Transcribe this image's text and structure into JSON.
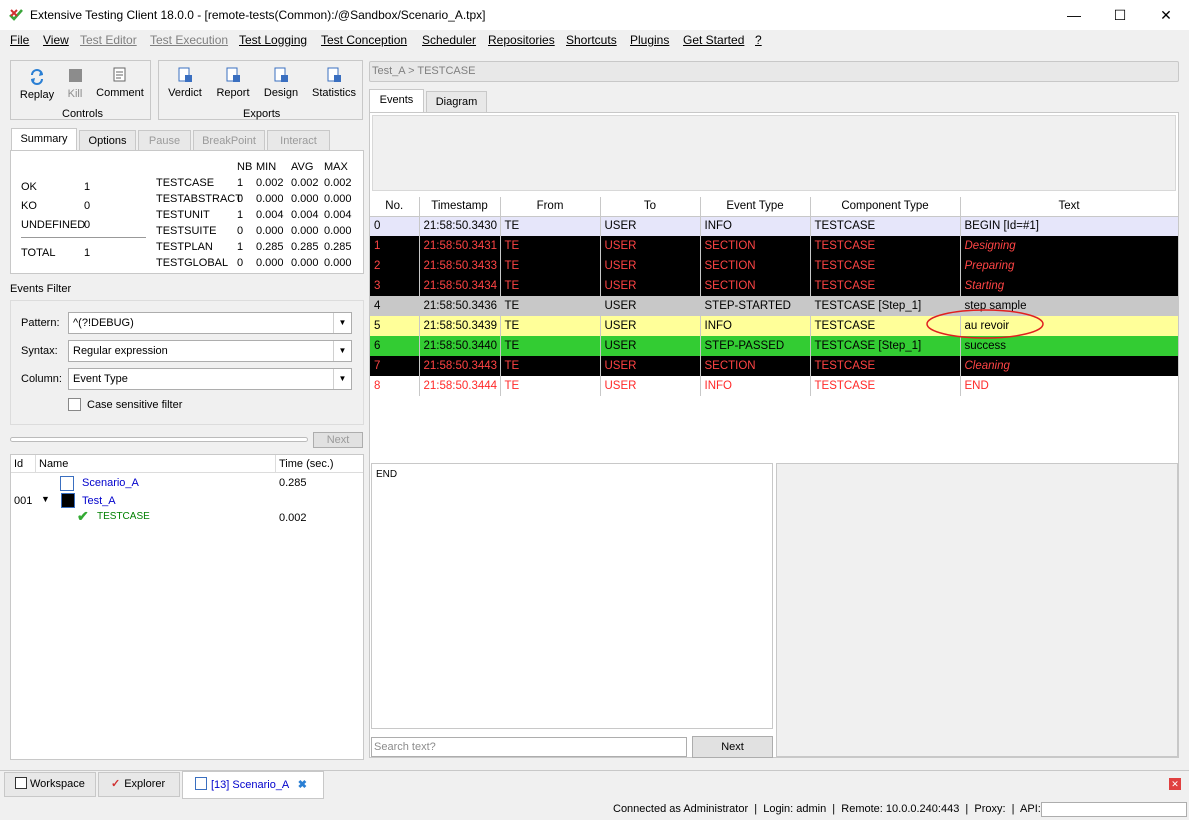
{
  "window": {
    "title": "Extensive Testing Client 18.0.0 - [remote-tests(Common):/@Sandbox/Scenario_A.tpx]",
    "min_glyph": "—",
    "max_glyph": "☐",
    "close_glyph": "✕"
  },
  "menu": [
    "File",
    "View",
    "Test Editor",
    "Test Execution",
    "Test Logging",
    "Test Conception",
    "Scheduler",
    "Repositories",
    "Shortcuts",
    "Plugins",
    "Get Started",
    "?"
  ],
  "controls": {
    "replay": "Replay",
    "kill": "Kill",
    "comment": "Comment",
    "group": "Controls"
  },
  "exports": {
    "verdict": "Verdict",
    "report": "Report",
    "design": "Design",
    "statistics": "Statistics",
    "group": "Exports"
  },
  "left_tabs": [
    "Summary",
    "Options",
    "Pause",
    "BreakPoint",
    "Interact"
  ],
  "summary": {
    "ok_label": "OK",
    "ok_val": "1",
    "ko_label": "KO",
    "ko_val": "0",
    "undef_label": "UNDEFINED",
    "undef_val": "0",
    "total_label": "TOTAL",
    "total_val": "1",
    "headers": [
      "NB",
      "MIN",
      "AVG",
      "MAX"
    ],
    "rows": [
      {
        "name": "TESTCASE",
        "nb": "1",
        "min": "0.002",
        "avg": "0.002",
        "max": "0.002"
      },
      {
        "name": "TESTABSTRACT",
        "nb": "0",
        "min": "0.000",
        "avg": "0.000",
        "max": "0.000"
      },
      {
        "name": "TESTUNIT",
        "nb": "1",
        "min": "0.004",
        "avg": "0.004",
        "max": "0.004"
      },
      {
        "name": "TESTSUITE",
        "nb": "0",
        "min": "0.000",
        "avg": "0.000",
        "max": "0.000"
      },
      {
        "name": "TESTPLAN",
        "nb": "1",
        "min": "0.285",
        "avg": "0.285",
        "max": "0.285"
      },
      {
        "name": "TESTGLOBAL",
        "nb": "0",
        "min": "0.000",
        "avg": "0.000",
        "max": "0.000"
      }
    ]
  },
  "filter": {
    "title": "Events Filter",
    "pattern_label": "Pattern:",
    "pattern_value": "^(?!DEBUG)",
    "syntax_label": "Syntax:",
    "syntax_value": "Regular expression",
    "column_label": "Column:",
    "column_value": "Event Type",
    "case_label": "Case sensitive filter",
    "next": "Next"
  },
  "tree": {
    "headers": [
      "Id",
      "Name",
      "Time (sec.)"
    ],
    "scenario": {
      "name": "Scenario_A",
      "time": "0.285"
    },
    "test": {
      "id": "001",
      "name": "Test_A"
    },
    "testcase": {
      "name": "TESTCASE",
      "time": "0.002"
    }
  },
  "breadcrumb": "Test_A > TESTCASE",
  "right_tabs": [
    "Events",
    "Diagram"
  ],
  "events": {
    "headers": [
      "No.",
      "Timestamp",
      "From",
      "To",
      "Event Type",
      "Component Type",
      "Text"
    ],
    "rows": [
      {
        "no": "0",
        "ts": "21:58:50.3430",
        "from": "TE",
        "to": "USER",
        "type": "INFO",
        "comp": "TESTCASE",
        "text": "BEGIN [Id=#1]",
        "style": "info-first"
      },
      {
        "no": "1",
        "ts": "21:58:50.3431",
        "from": "TE",
        "to": "USER",
        "type": "SECTION",
        "comp": "TESTCASE",
        "text": "Designing",
        "style": "section"
      },
      {
        "no": "2",
        "ts": "21:58:50.3433",
        "from": "TE",
        "to": "USER",
        "type": "SECTION",
        "comp": "TESTCASE",
        "text": "Preparing",
        "style": "section"
      },
      {
        "no": "3",
        "ts": "21:58:50.3434",
        "from": "TE",
        "to": "USER",
        "type": "SECTION",
        "comp": "TESTCASE",
        "text": "Starting",
        "style": "section"
      },
      {
        "no": "4",
        "ts": "21:58:50.3436",
        "from": "TE",
        "to": "USER",
        "type": "STEP-STARTED",
        "comp": "TESTCASE [Step_1]",
        "text": "step sample",
        "style": "started"
      },
      {
        "no": "5",
        "ts": "21:58:50.3439",
        "from": "TE",
        "to": "USER",
        "type": "INFO",
        "comp": "TESTCASE",
        "text": "au revoir",
        "style": "info"
      },
      {
        "no": "6",
        "ts": "21:58:50.3440",
        "from": "TE",
        "to": "USER",
        "type": "STEP-PASSED",
        "comp": "TESTCASE [Step_1]",
        "text": "success",
        "style": "passed"
      },
      {
        "no": "7",
        "ts": "21:58:50.3443",
        "from": "TE",
        "to": "USER",
        "type": "SECTION",
        "comp": "TESTCASE",
        "text": "Cleaning",
        "style": "section"
      },
      {
        "no": "8",
        "ts": "21:58:50.3444",
        "from": "TE",
        "to": "USER",
        "type": "INFO",
        "comp": "TESTCASE",
        "text": "END",
        "style": "end"
      }
    ]
  },
  "detail_text": "END",
  "search": {
    "placeholder": "Search text?",
    "next": "Next"
  },
  "bottom_tabs": [
    "Workspace",
    "Explorer",
    "[13] Scenario_A"
  ],
  "status": "Connected as Administrator  |  Login: admin  |  Remote: 10.0.0.240:443  |  Proxy:  |  API:",
  "colors": {
    "section_bg": "#000000",
    "section_fg": "#ff4545",
    "passed": "#33cc33",
    "info": "#ffff99",
    "started": "#c8c8c8",
    "link": "#0000cc"
  }
}
